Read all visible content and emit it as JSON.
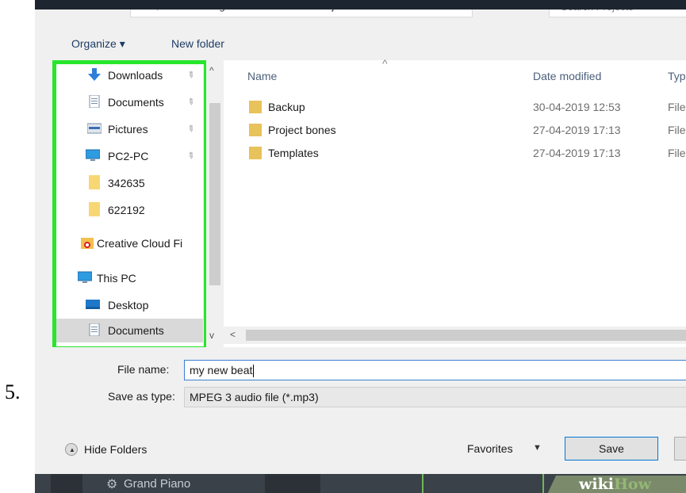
{
  "step_number": "5.",
  "address_bar": {
    "path": "« Image-Line › FL Studio › Projects",
    "search_placeholder": "Search Projects"
  },
  "toolbar": {
    "organize_label": "Organize ▾",
    "new_folder_label": "New folder"
  },
  "nav_pane": {
    "items": [
      {
        "label": "Downloads",
        "icon": "download-arrow-icon",
        "pinned": true
      },
      {
        "label": "Documents",
        "icon": "document-icon",
        "pinned": true
      },
      {
        "label": "Pictures",
        "icon": "pictures-icon",
        "pinned": true
      },
      {
        "label": "PC2-PC",
        "icon": "monitor-icon",
        "pinned": true
      },
      {
        "label": "342635",
        "icon": "folder-icon",
        "pinned": false
      },
      {
        "label": "622192",
        "icon": "folder-icon",
        "pinned": false
      },
      {
        "label": "Creative Cloud Fi",
        "icon": "creative-cloud-folder-icon",
        "pinned": false
      },
      {
        "label": "This PC",
        "icon": "monitor-icon",
        "pinned": false
      },
      {
        "label": "Desktop",
        "icon": "desktop-icon",
        "pinned": false
      },
      {
        "label": "Documents",
        "icon": "document-icon",
        "pinned": false,
        "selected": true
      }
    ],
    "highlight_color": "#27e62c"
  },
  "file_list": {
    "columns": {
      "name": "Name",
      "date": "Date modified",
      "type": "Typ"
    },
    "rows": [
      {
        "name": "Backup",
        "date": "30-04-2019 12:53",
        "type": "File"
      },
      {
        "name": "Project bones",
        "date": "27-04-2019 17:13",
        "type": "File"
      },
      {
        "name": "Templates",
        "date": "27-04-2019 17:13",
        "type": "File"
      }
    ]
  },
  "form": {
    "file_name_label": "File name:",
    "file_name_value": "my new beat",
    "save_type_label": "Save as type:",
    "save_type_value": "MPEG 3 audio file (*.mp3)"
  },
  "footer": {
    "hide_folders_label": "Hide Folders",
    "favorites_label": "Favorites",
    "save_label": "Save"
  },
  "background_app": {
    "instrument_label": "Grand Piano"
  },
  "watermark": {
    "wiki": "wiki",
    "how": "How"
  }
}
